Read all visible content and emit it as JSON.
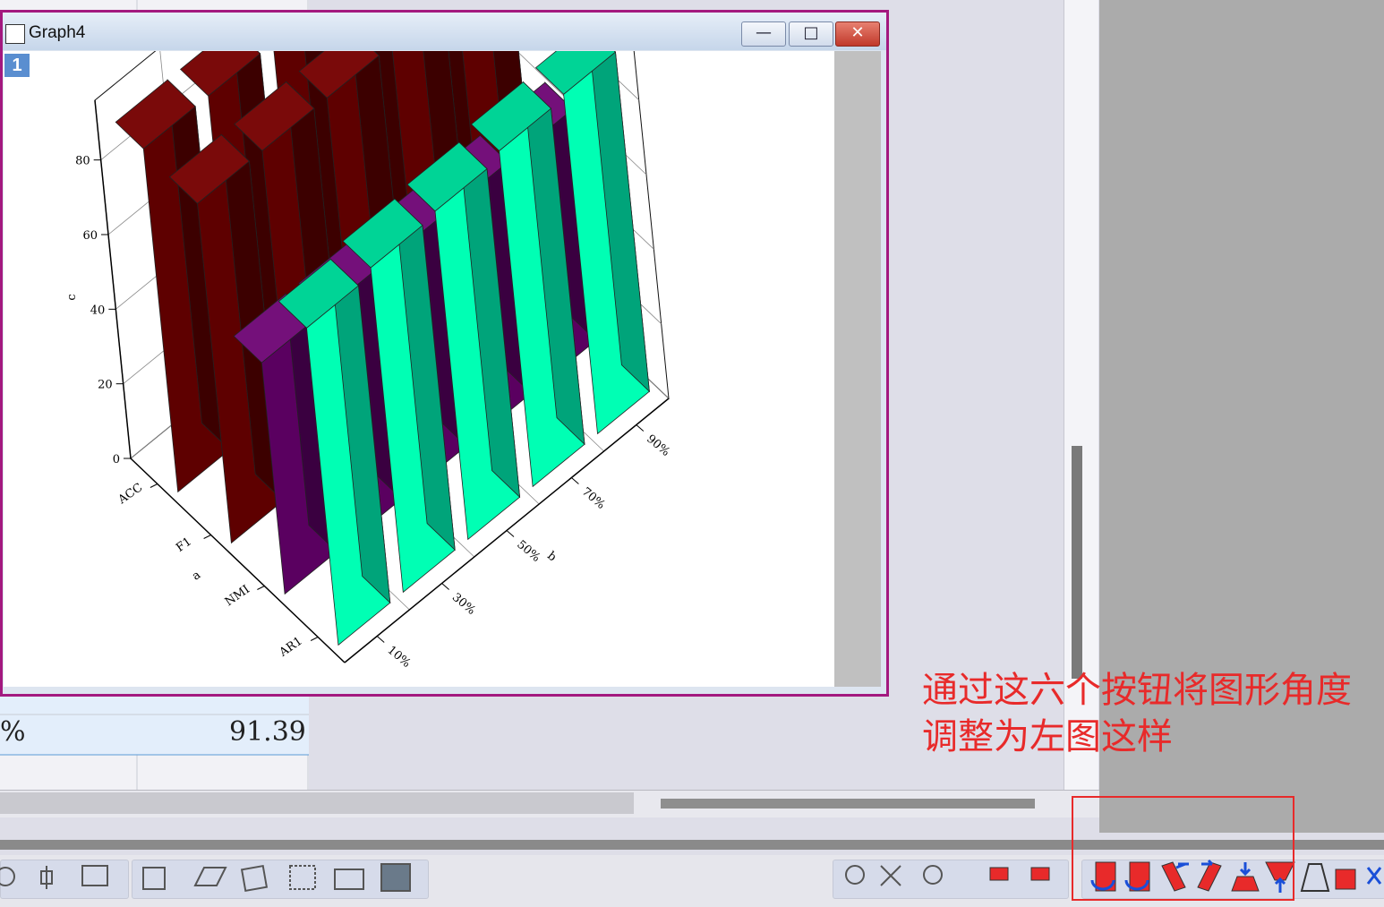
{
  "window": {
    "title": "Graph4",
    "layer_label": "1",
    "buttons": {
      "minimize": "—",
      "maximize": "□",
      "close": "✕"
    }
  },
  "worksheet": {
    "visible_rows": [
      {
        "c1": "%",
        "c2": "91.4"
      },
      {
        "c1": "%",
        "c2": "91.39"
      }
    ]
  },
  "annotation": {
    "line1": "通过这六个按钮将图形角度",
    "line2": "调整为左图这样"
  },
  "toolbar": {
    "icons": [
      "bar-3d-icon",
      "wireframe-icon",
      "surface-icon",
      "scatter-3d-icon",
      "matrix-icon",
      "contour-icon",
      "image-icon",
      "mask-on-icon",
      "mask-off-icon",
      "face-icon",
      "swap-axes-icon",
      "stack-arrows-icon",
      "reorder-icon",
      "rotate-ccw-icon",
      "rotate-cw-icon",
      "tilt-left-icon",
      "tilt-right-icon",
      "move-down-icon",
      "move-up-icon",
      "perspective-icon",
      "reset-view-icon"
    ]
  },
  "colors": {
    "accent": "#a3197f",
    "annotation": "#e82a2a",
    "acc_f1": "#6b0000",
    "nmi": "#6a0070",
    "ar1": "#00ffb4"
  },
  "chart_data": {
    "type": "bar",
    "projection": "3d",
    "title": "",
    "xlabel": "b",
    "ylabel": "a",
    "zlabel": "c",
    "x_categories": [
      "10%",
      "30%",
      "50%",
      "70%",
      "90%"
    ],
    "y_categories": [
      "ACC",
      "F1",
      "NMI",
      "AR1"
    ],
    "zlim": [
      0,
      90
    ],
    "z_ticks": [
      "0",
      "20",
      "40",
      "60",
      "80"
    ],
    "grid": true,
    "series": [
      {
        "name": "ACC",
        "values": [
          92,
          92,
          92,
          92,
          92
        ]
      },
      {
        "name": "F1",
        "values": [
          91,
          91,
          91,
          91,
          91
        ]
      },
      {
        "name": "NMI",
        "values": [
          62,
          62,
          62,
          62,
          62
        ]
      },
      {
        "name": "AR1",
        "values": [
          85,
          87,
          88,
          90,
          91
        ]
      }
    ]
  }
}
